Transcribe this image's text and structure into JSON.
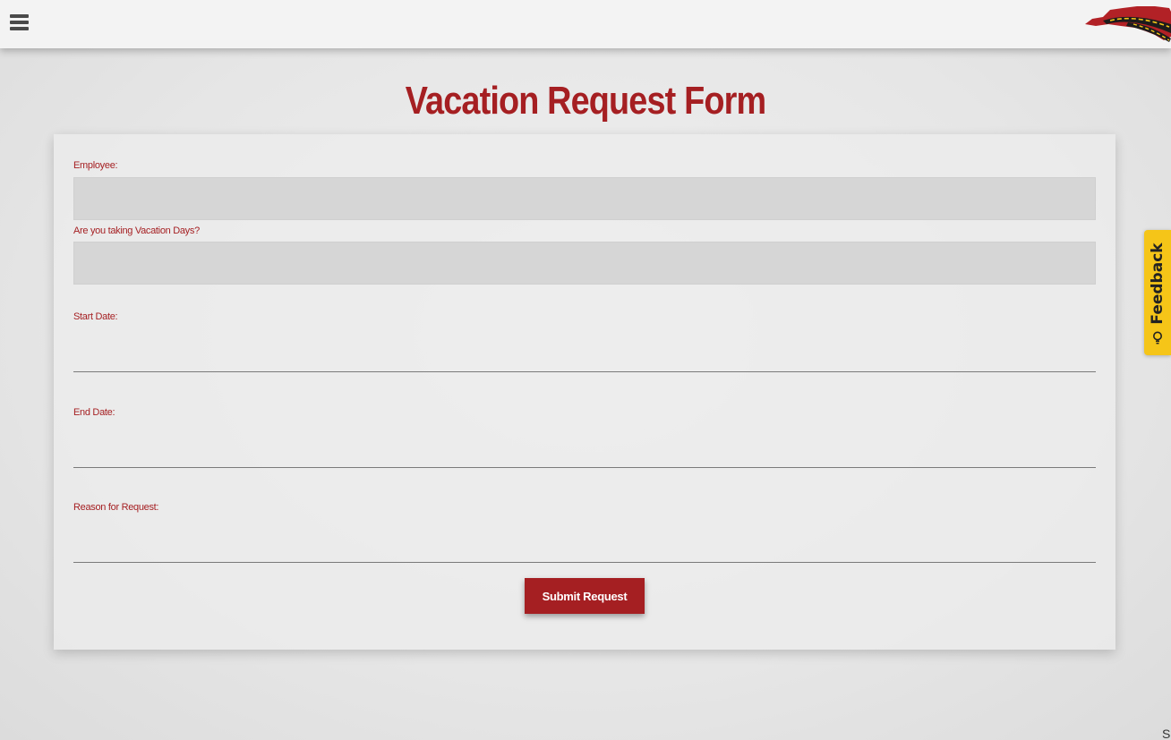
{
  "header": {
    "menu_icon": "hamburger-menu-icon",
    "logo_icon": "state-map-road-logo"
  },
  "page": {
    "title": "Vacation Request Form"
  },
  "form": {
    "employee_label": "Employee:",
    "vacation_days_label": "Are you taking Vacation Days?",
    "start_date_label": "Start Date:",
    "end_date_label": "End Date:",
    "reason_label": "Reason for Request:",
    "employee_value": "",
    "vacation_days_value": "",
    "start_date_value": "",
    "end_date_value": "",
    "reason_value": "",
    "submit_label": "Submit Request"
  },
  "feedback": {
    "label": "Feedback",
    "icon": "lightbulb-icon"
  },
  "corner_text": "S",
  "colors": {
    "accent": "#a51f22",
    "feedback_bg": "#f5c518",
    "select_bg": "#d6d6d6"
  }
}
